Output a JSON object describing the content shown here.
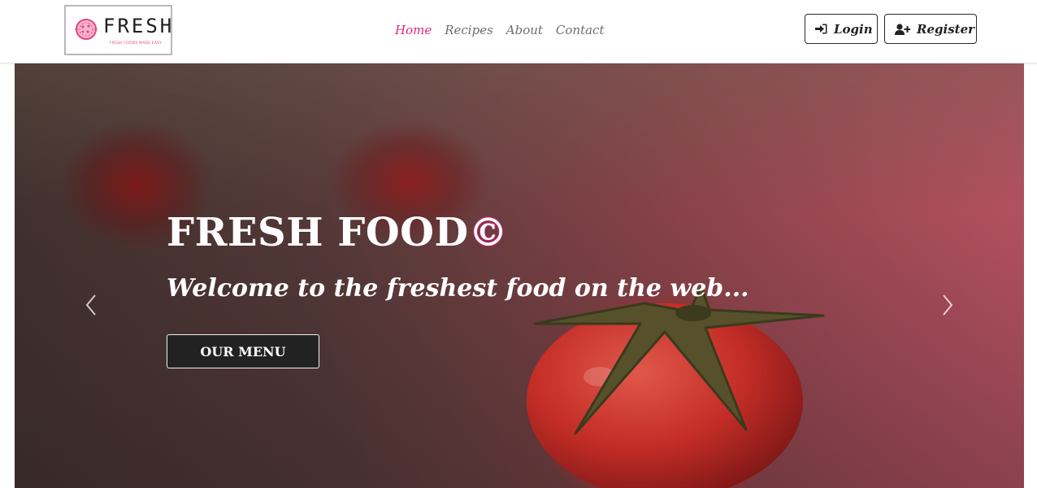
{
  "brand": {
    "name": "FRESH",
    "tagline": "FRESH FOODS MADE EASY",
    "accent_color": "#e0257a"
  },
  "nav": {
    "links": [
      {
        "label": "Home",
        "active": true
      },
      {
        "label": "Recipes",
        "active": false
      },
      {
        "label": "About",
        "active": false
      },
      {
        "label": "Contact",
        "active": false
      }
    ],
    "login_label": "Login",
    "login_icon": "sign-in-icon",
    "register_label": "Register",
    "register_icon": "user-plus-icon"
  },
  "hero": {
    "title": "FRESH FOOD",
    "title_mark": "©",
    "subtitle": "Welcome to the freshest food on the web...",
    "cta_label": "OUR MENU",
    "prev_icon": "chevron-left-icon",
    "next_icon": "chevron-right-icon"
  }
}
